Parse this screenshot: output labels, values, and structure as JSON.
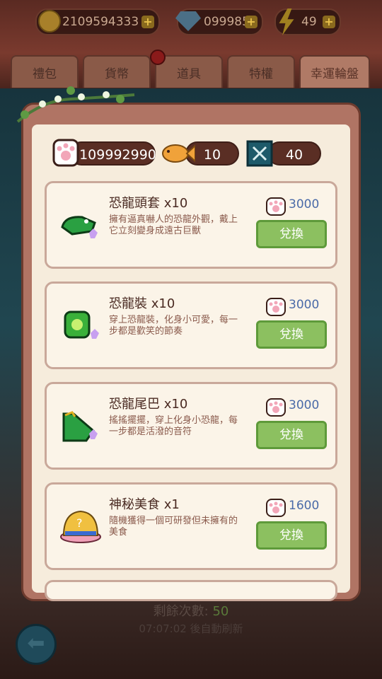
{
  "currency": {
    "coins": "2109594333",
    "gems": "099985",
    "energy": "49"
  },
  "tabs": [
    {
      "label": "禮包"
    },
    {
      "label": "貨幣"
    },
    {
      "label": "道具"
    },
    {
      "label": "特權"
    },
    {
      "label": "幸運輪盤"
    }
  ],
  "resources": {
    "paw": "2109992990",
    "fish": "10",
    "book": "40"
  },
  "items": [
    {
      "title": "恐龍頭套 x10",
      "desc": "擁有逼真嚇人的恐龍外觀，戴上它立刻變身成遠古巨獸",
      "price": "3000",
      "button": "兌換",
      "icon": "dino-head-icon"
    },
    {
      "title": "恐龍裝 x10",
      "desc": "穿上恐龍裝，化身小可愛，每一步都是歡笑的節奏",
      "price": "3000",
      "button": "兌換",
      "icon": "dino-suit-icon"
    },
    {
      "title": "恐龍尾巴 x10",
      "desc": "搖搖擺擺，穿上化身小恐龍，每一步都是活潑的音符",
      "price": "3000",
      "button": "兌換",
      "icon": "dino-tail-icon"
    },
    {
      "title": "神秘美食 x1",
      "desc": "隨機獲得一個可研發但未擁有的美食",
      "price": "1600",
      "button": "兌換",
      "icon": "mystery-food-icon"
    }
  ],
  "footer": {
    "remaining_label": "剩餘次數: ",
    "remaining_count": "50",
    "refresh_text": "07:07:02 後自動刷新"
  }
}
